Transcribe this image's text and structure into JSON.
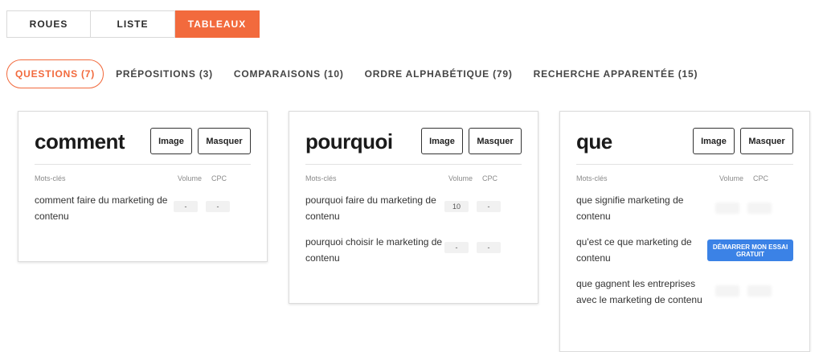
{
  "view_tabs": [
    {
      "label": "ROUES",
      "active": false
    },
    {
      "label": "LISTE",
      "active": false
    },
    {
      "label": "TABLEAUX",
      "active": true
    }
  ],
  "filters": [
    {
      "label": "QUESTIONS (7)",
      "active": true
    },
    {
      "label": "PRÉPOSITIONS (3)",
      "active": false
    },
    {
      "label": "COMPARAISONS (10)",
      "active": false
    },
    {
      "label": "ORDRE ALPHABÉTIQUE (79)",
      "active": false
    },
    {
      "label": "RECHERCHE APPARENTÉE (15)",
      "active": false
    }
  ],
  "columns": {
    "keywords": "Mots-clés",
    "volume": "Volume",
    "cpc": "CPC"
  },
  "buttons": {
    "image": "Image",
    "hide": "Masquer",
    "trial": "DÉMARRER MON ESSAI GRATUIT"
  },
  "cards": [
    {
      "title": "comment",
      "rows": [
        {
          "keyword": "comment faire du marketing de contenu",
          "volume": "-",
          "cpc": "-"
        }
      ]
    },
    {
      "title": "pourquoi",
      "rows": [
        {
          "keyword": "pourquoi faire du marketing de contenu",
          "volume": "10",
          "cpc": "-"
        },
        {
          "keyword": "pourquoi choisir le marketing de contenu",
          "volume": "-",
          "cpc": "-"
        }
      ]
    },
    {
      "title": "que",
      "rows": [
        {
          "keyword": "que signifie marketing de contenu",
          "volume": "",
          "cpc": ""
        },
        {
          "keyword": "qu'est ce que marketing de contenu",
          "volume": "",
          "cpc": ""
        },
        {
          "keyword": "que gagnent les entreprises avec le marketing de contenu",
          "volume": "",
          "cpc": ""
        }
      ]
    }
  ],
  "colors": {
    "accent": "#f26a3d",
    "trial_button": "#3b82e6"
  }
}
